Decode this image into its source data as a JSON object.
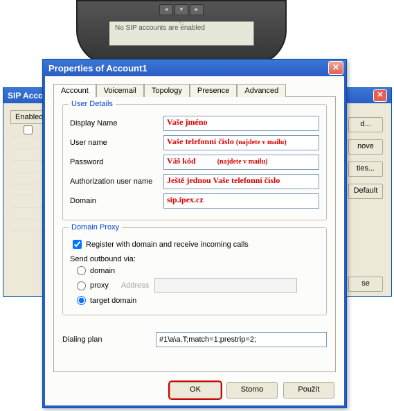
{
  "phone": {
    "status": "No SIP accounts are enabled"
  },
  "back_window": {
    "title": "SIP Accoun",
    "col_header": "Enabled",
    "buttons": {
      "add": "d...",
      "remove": "nove",
      "properties": "ties...",
      "default": "Default",
      "close": "se"
    }
  },
  "dialog": {
    "title": "Properties of Account1",
    "tabs": {
      "account": "Account",
      "voicemail": "Voicemail",
      "topology": "Topology",
      "presence": "Presence",
      "advanced": "Advanced"
    },
    "user_details": {
      "legend": "User Details",
      "display_name_label": "Display Name",
      "display_name_value": "Vaše jméno",
      "username_label": "User name",
      "username_value": "Vaše telefonní číslo",
      "username_hint": "(najdete v mailu)",
      "password_label": "Password",
      "password_value": "Váš kód",
      "password_hint": "(najdete v mailu)",
      "auth_label": "Authorization user name",
      "auth_value": "Ještě jednou Vaše telefonní číslo",
      "domain_label": "Domain",
      "domain_value": "sip.ipex.cz"
    },
    "domain_proxy": {
      "legend": "Domain Proxy",
      "register_label": "Register with domain and receive incoming calls",
      "send_label": "Send outbound via:",
      "opt_domain": "domain",
      "opt_proxy": "proxy",
      "address_label": "Address",
      "opt_target": "target domain"
    },
    "dialing": {
      "label": "Dialing plan",
      "value": "#1\\a\\a.T;match=1;prestrip=2;"
    },
    "buttons": {
      "ok": "OK",
      "storno": "Storno",
      "pouzit": "Použít"
    }
  }
}
